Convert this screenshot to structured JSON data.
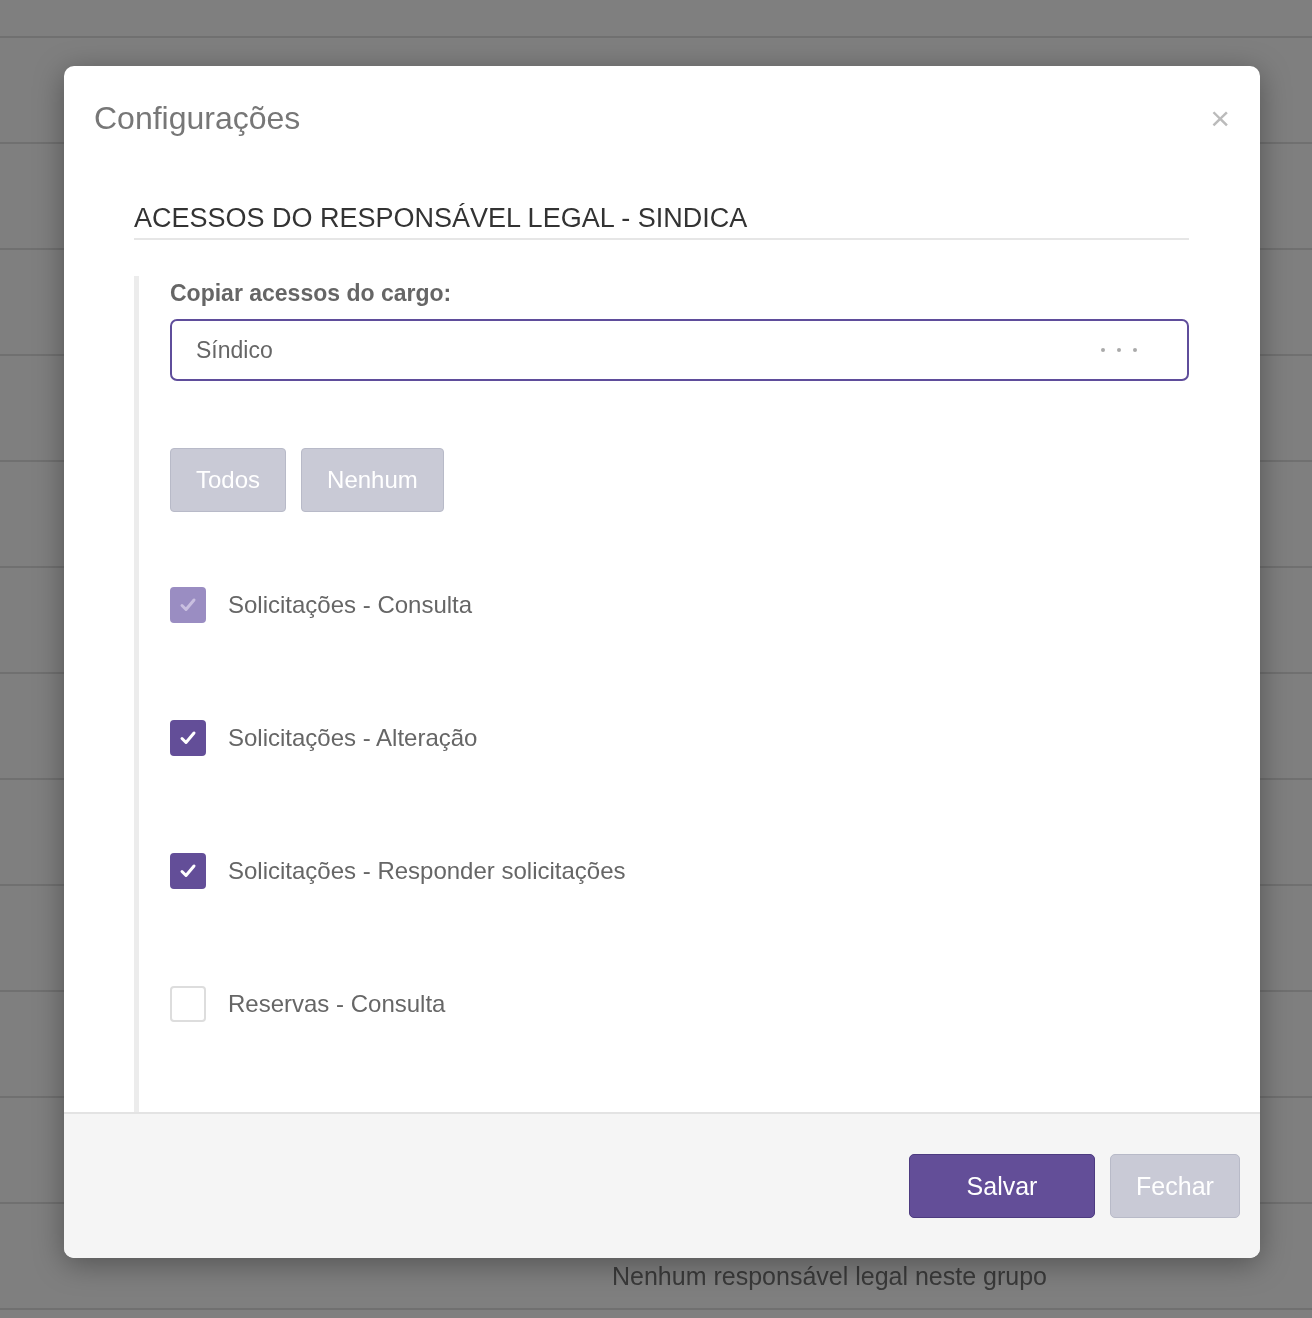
{
  "background": {
    "message": "Nenhum responsável legal neste grupo"
  },
  "dialog": {
    "title": "Configurações",
    "close": "×",
    "section_title": "ACESSOS DO RESPONSÁVEL LEGAL - SINDICA",
    "copy_field": {
      "label": "Copiar acessos do cargo:",
      "value": "Síndico"
    },
    "select_buttons": [
      "Todos",
      "Nenhum"
    ],
    "permissions": [
      {
        "label": "Solicitações - Consulta",
        "checked": true,
        "disabled": true
      },
      {
        "label": "Solicitações - Alteração",
        "checked": true,
        "disabled": false
      },
      {
        "label": "Solicitações - Responder solicitações",
        "checked": true,
        "disabled": false
      },
      {
        "label": "Reservas - Consulta",
        "checked": false,
        "disabled": false
      }
    ],
    "footer_buttons": [
      {
        "label": "Salvar",
        "kind": "primary"
      },
      {
        "label": "Fechar",
        "kind": "secondary"
      }
    ]
  }
}
